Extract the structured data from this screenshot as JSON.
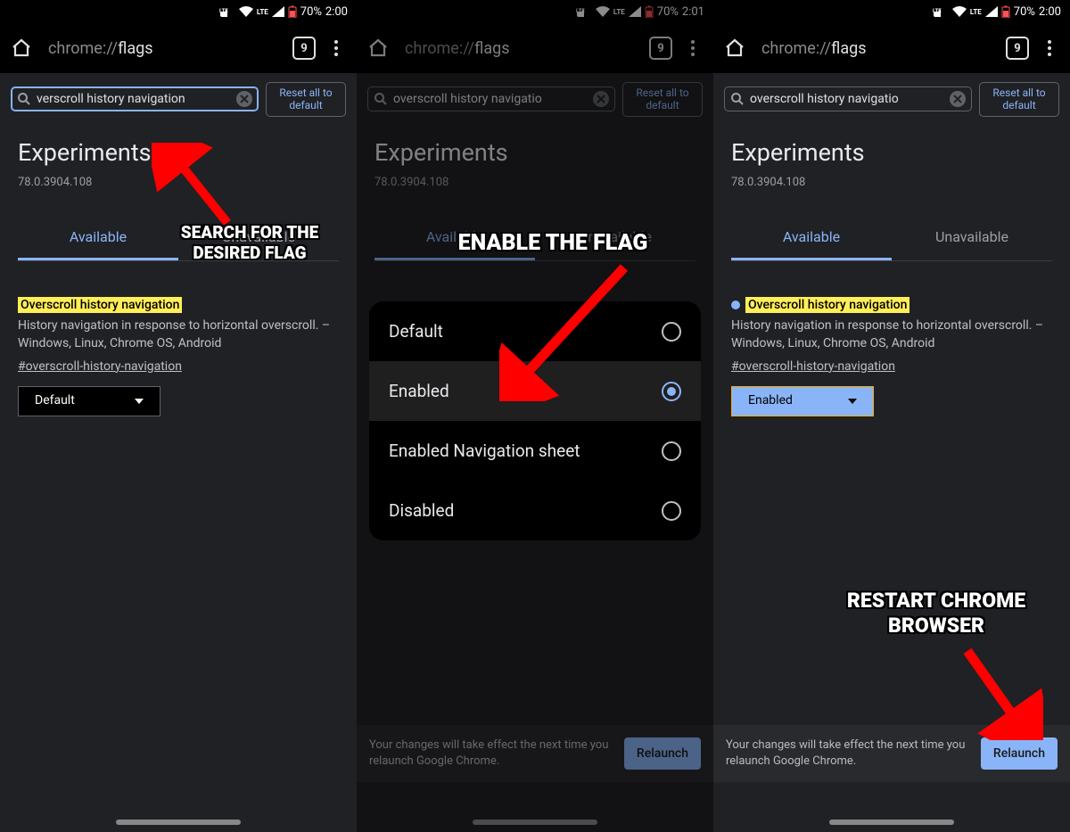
{
  "status": {
    "battery_pct": "70%",
    "time_left": "2:00",
    "time_mid": "2:01",
    "time_right": "2:00"
  },
  "urlbar": {
    "prefix": "chrome://",
    "slug": "flags",
    "tab_count": "9"
  },
  "search": {
    "value_left": "verscroll history navigation",
    "value_mid": "overscroll history navigatio",
    "value_right": "overscroll history navigatio",
    "reset_label": "Reset all to default"
  },
  "page": {
    "title": "Experiments",
    "version": "78.0.3904.108",
    "tabs": {
      "available": "Available",
      "unavailable": "Unavailable"
    }
  },
  "flag": {
    "title": "Overscroll history navigation",
    "description": "History navigation in response to horizontal overscroll. – Windows, Linux, Chrome OS, Android",
    "anchor": "#overscroll-history-navigation",
    "select_default": "Default",
    "select_enabled": "Enabled"
  },
  "popup_options": [
    {
      "label": "Default",
      "selected": false
    },
    {
      "label": "Enabled",
      "selected": true
    },
    {
      "label": "Enabled Navigation sheet",
      "selected": false
    },
    {
      "label": "Disabled",
      "selected": false
    }
  ],
  "relaunch": {
    "message": "Your changes will take effect the next time you relaunch Google Chrome.",
    "button": "Relaunch"
  },
  "annotations": {
    "left": "SEARCH FOR THE DESIRED FLAG",
    "mid": "ENABLE THE FLAG",
    "right": "RESTART CHROME BROWSER"
  }
}
